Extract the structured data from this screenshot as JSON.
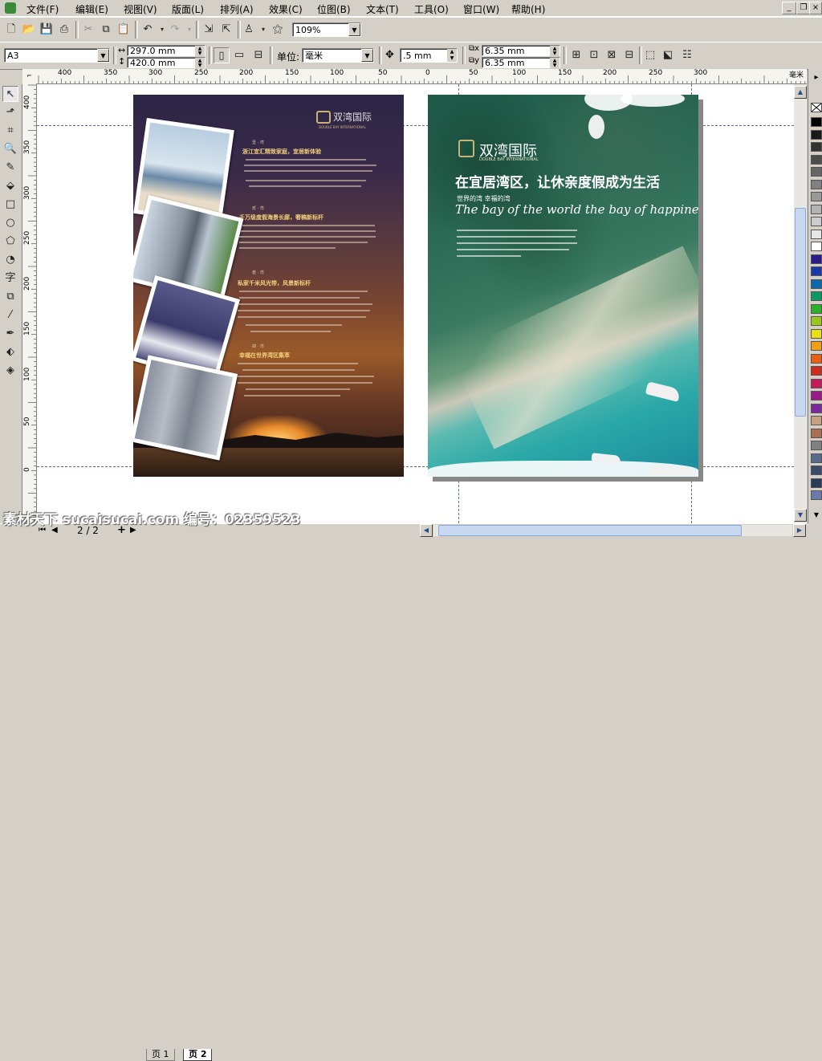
{
  "menu": {
    "items": [
      "文件(F)",
      "编辑(E)",
      "视图(V)",
      "版面(L)",
      "排列(A)",
      "效果(C)",
      "位图(B)",
      "文本(T)",
      "工具(O)",
      "窗口(W)",
      "帮助(H)"
    ]
  },
  "toolbar": {
    "zoom_value": "109%",
    "icons": [
      "new-icon",
      "open-icon",
      "save-icon",
      "print-icon",
      "cut-icon",
      "copy-icon",
      "paste-icon",
      "undo-icon",
      "redo-icon",
      "import-icon",
      "export-icon",
      "app-launcher-icon",
      "corel-online-icon"
    ]
  },
  "property_bar": {
    "paper_size": "A3",
    "width": "297.0 mm",
    "height": "420.0 mm",
    "units_label": "单位:",
    "units_value": "毫米",
    "nudge": ".5 mm",
    "dup_x": "6.35 mm",
    "dup_y": "6.35 mm"
  },
  "ruler": {
    "h_labels": [
      "400",
      "350",
      "300",
      "250",
      "200",
      "150",
      "100",
      "50",
      "0",
      "50",
      "100",
      "150",
      "200",
      "250",
      "300"
    ],
    "unit": "毫米",
    "v_labels": [
      "400",
      "350",
      "300",
      "250",
      "200",
      "150",
      "100",
      "50",
      "0"
    ]
  },
  "page1": {
    "logo_cn": "双湾国际",
    "logo_en": "DOUBLE BAY INTERNATIONAL",
    "sections": [
      {
        "num": "壹 · 湾",
        "title": "浙江宜汇精致家庭，宜居新体验"
      },
      {
        "num": "贰 · 湾",
        "title": "千万级度假海景长廊，奢稿新标杆"
      },
      {
        "num": "叁 · 湾",
        "title": "私家千米风光带，风景新标杆"
      },
      {
        "num": "肆 · 湾",
        "title": "幸福在世界湾区集萃"
      }
    ]
  },
  "page2": {
    "logo_cn": "双湾国际",
    "logo_en": "DOUBLE BAY INTERNATIONAL",
    "headline": "在宜居湾区，让休亲度假成为生活",
    "subline": "世界的湾 幸福的湾",
    "english": "The bay of the world the bay of happiness"
  },
  "status": {
    "page_counter": "2 / 2",
    "tabs": [
      "页 1",
      "页 2"
    ]
  },
  "watermark": "素材天下 sucaisucai.com   编号：02359523",
  "palette_colors": [
    "#000000",
    "#1a1a1a",
    "#333333",
    "#4d4d4d",
    "#666666",
    "#808080",
    "#999999",
    "#b3b3b3",
    "#cccccc",
    "#e6e6e6",
    "#ffffff",
    "#2a1a8a",
    "#1a3aaa",
    "#0a6ab0",
    "#0a9a6a",
    "#2ab02a",
    "#9ac81a",
    "#e8e010",
    "#f0a010",
    "#e86010",
    "#d02a1a",
    "#c81a5a",
    "#9a1a8a",
    "#7a2a9a",
    "#c8a080",
    "#a87050",
    "#808080",
    "#5a6a8a",
    "#3a4a6a",
    "#2a3a5a",
    "#6a7aaa"
  ]
}
